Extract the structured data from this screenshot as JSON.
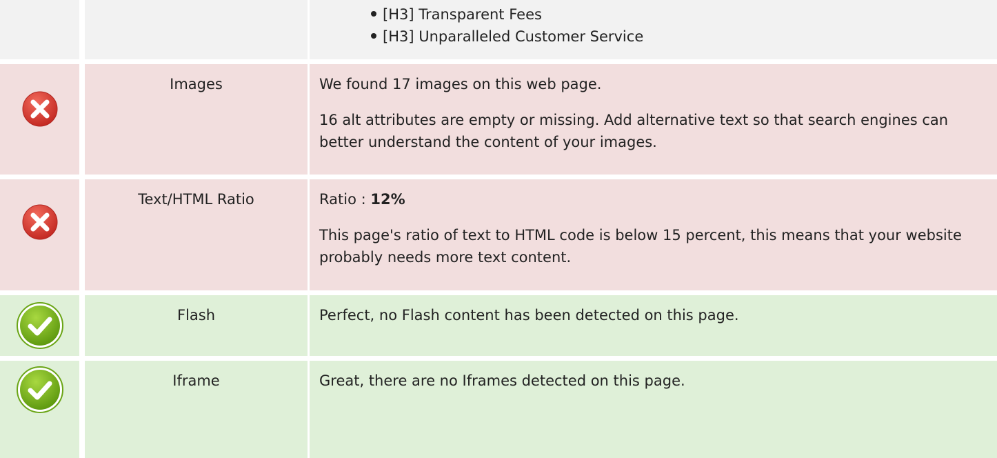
{
  "headings_continued": {
    "items": [
      "[H3] Transparent Fees",
      "[H3] Unparalleled Customer Service"
    ]
  },
  "checks": [
    {
      "status": "fail",
      "name": "Images",
      "lines": [
        "We found 17 images on this web page.",
        "16 alt attributes are empty or missing. Add alternative text so that search engines can better understand the content of your images."
      ]
    },
    {
      "status": "fail",
      "name": "Text/HTML Ratio",
      "ratio_label": "Ratio :",
      "ratio_value": "12%",
      "lines": [
        "This page's ratio of text to HTML code is below 15 percent, this means that your website probably needs more text content."
      ]
    },
    {
      "status": "pass",
      "name": "Flash",
      "lines": [
        "Perfect, no Flash content has been detected on this page."
      ]
    },
    {
      "status": "pass",
      "name": "Iframe",
      "lines": [
        "Great, there are no Iframes detected on this page."
      ]
    }
  ],
  "icons": {
    "fail": "error-x-icon",
    "pass": "check-mark-icon"
  },
  "colors": {
    "fail_background": "#f2dede",
    "pass_background": "#dff0d8",
    "neutral_background": "#f2f2f2",
    "fail_icon": "#d9302f",
    "pass_icon": "#7cb518"
  }
}
